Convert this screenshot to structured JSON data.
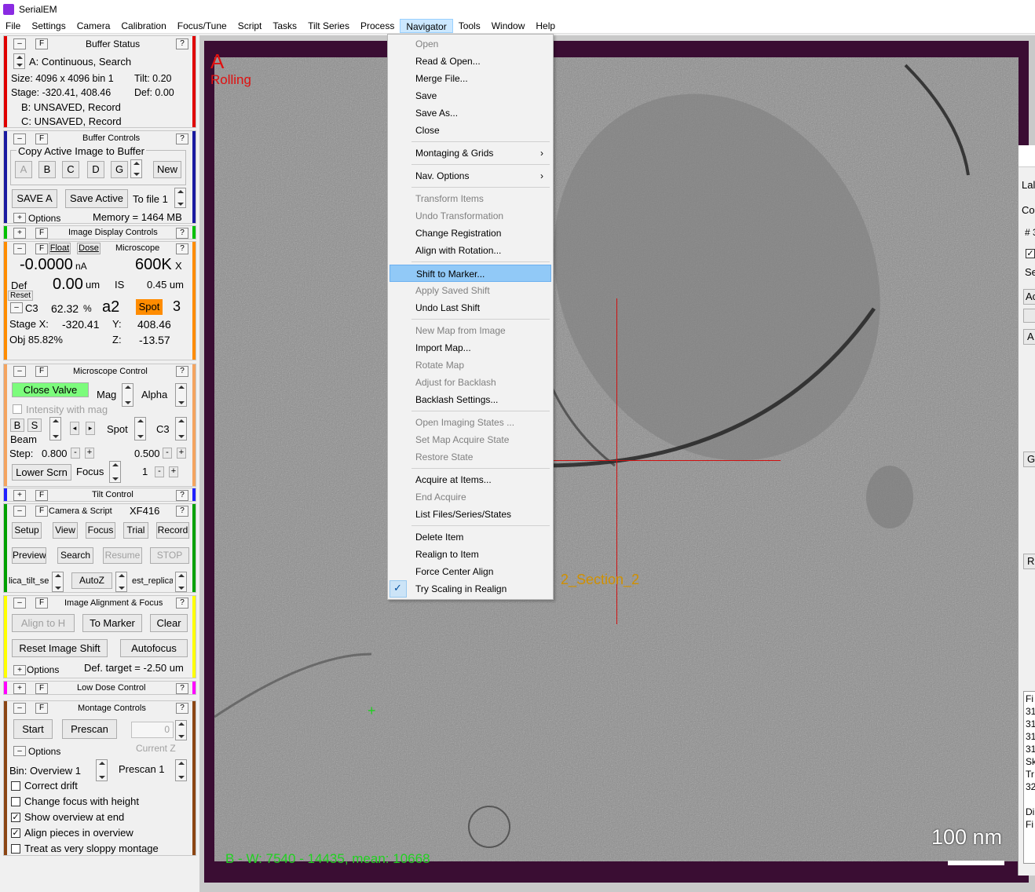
{
  "window": {
    "title": "SerialEM"
  },
  "menubar": [
    "File",
    "Settings",
    "Camera",
    "Calibration",
    "Focus/Tune",
    "Script",
    "Tasks",
    "Tilt Series",
    "Process",
    "Navigator",
    "Tools",
    "Window",
    "Help"
  ],
  "buffer_status": {
    "title": "Buffer Status",
    "line1": "A: Continuous, Search",
    "size": "Size: 4096 x 4096  bin 1",
    "tilt": "Tilt: 0.20",
    "stage": "Stage: -320.41, 408.46",
    "def": "Def: 0.00",
    "b": "B: UNSAVED, Record",
    "c": "C: UNSAVED, Record"
  },
  "buffer_controls": {
    "title": "Buffer Controls",
    "group": "Copy Active Image to Buffer",
    "buttons": [
      "A",
      "B",
      "C",
      "D",
      "G"
    ],
    "new": "New",
    "save_a": "SAVE A",
    "save_active": "Save Active",
    "to_file": "To file 1",
    "options": "Options",
    "memory": "Memory = 1464 MB"
  },
  "image_display": {
    "title": "Image Display Controls"
  },
  "microscope": {
    "float": "Float",
    "dose": "Dose",
    "title": "Microscope",
    "current": "-0.0000",
    "current_unit": "nA",
    "mag": "600K",
    "mag_x": "X",
    "def_label": "Def",
    "def_val": "0.00",
    "def_unit": "um",
    "is_label": "IS",
    "is_val": "0.45 um",
    "reset": "Reset",
    "c3_label": "C3",
    "c3_val": "62.32",
    "c3_pct": "%",
    "a2": "a2",
    "spot_label": "Spot",
    "spot_val": "3",
    "stagex_label": "Stage X:",
    "stagex": "-320.41",
    "y_label": "Y:",
    "y": "408.46",
    "obj": "Obj  85.82%",
    "z_label": "Z:",
    "z": "-13.57"
  },
  "microscope_control": {
    "title": "Microscope Control",
    "close_valve": "Close Valve",
    "mag": "Mag",
    "alpha": "Alpha",
    "intensity": "Intensity with mag",
    "b": "B",
    "s": "S",
    "beam": "Beam",
    "spot": "Spot",
    "c3": "C3",
    "step": "Step:",
    "step_val": "0.800",
    "step2": "0.500",
    "lower": "Lower Scrn",
    "focus": "Focus",
    "one": "1"
  },
  "tilt_control": {
    "title": "Tilt Control"
  },
  "camera_script": {
    "title": "Camera & Script",
    "camera": "XF416",
    "buttons1": [
      "Setup",
      "View",
      "Focus",
      "Trial",
      "Record"
    ],
    "buttons2": [
      "Preview",
      "Search",
      "Resume",
      "STOP"
    ],
    "script1": "lica_tilt_se",
    "autoz": "AutoZ",
    "script2": "est_replica"
  },
  "image_alignment": {
    "title": "Image Alignment & Focus",
    "align_to": "Align to H",
    "to_marker": "To Marker",
    "clear": "Clear",
    "reset_shift": "Reset Image Shift",
    "autofocus": "Autofocus",
    "options": "Options",
    "def_target": "Def. target = -2.50 um"
  },
  "low_dose": {
    "title": "Low Dose Control"
  },
  "montage": {
    "title": "Montage Controls",
    "start": "Start",
    "prescan": "Prescan",
    "zero": "0",
    "current_z": "Current Z",
    "options": "Options",
    "bin": "Bin: Overview 1",
    "prescan1": "Prescan 1",
    "opts": [
      {
        "label": "Correct drift",
        "checked": false
      },
      {
        "label": "Change focus with height",
        "checked": false
      },
      {
        "label": "Show overview at end",
        "checked": true
      },
      {
        "label": "Align pieces in overview",
        "checked": true
      },
      {
        "label": "Treat as very sloppy montage",
        "checked": false
      }
    ]
  },
  "image": {
    "buffer_letter": "A",
    "mode": "Rolling",
    "label": "2_Section_2",
    "scale": "100 nm",
    "stats": "B - W: 7540 - 14435, mean: 10668"
  },
  "navigator_menu": {
    "items": [
      {
        "label": "Open",
        "disabled": true
      },
      {
        "label": "Read & Open...",
        "disabled": false
      },
      {
        "label": "Merge File...",
        "disabled": false
      },
      {
        "label": "Save",
        "disabled": false
      },
      {
        "label": "Save As...",
        "disabled": false
      },
      {
        "label": "Close",
        "disabled": false
      },
      {
        "label": "Montaging & Grids",
        "disabled": false,
        "submenu": true
      },
      {
        "label": "Nav. Options",
        "disabled": false,
        "submenu": true
      },
      {
        "label": "Transform Items",
        "disabled": true
      },
      {
        "label": "Undo Transformation",
        "disabled": true
      },
      {
        "label": "Change Registration",
        "disabled": false
      },
      {
        "label": "Align with Rotation...",
        "disabled": false
      },
      {
        "label": "Shift to Marker...",
        "disabled": false,
        "highlighted": true
      },
      {
        "label": "Apply Saved Shift",
        "disabled": true
      },
      {
        "label": "Undo Last Shift",
        "disabled": false
      },
      {
        "label": "New Map from Image",
        "disabled": true
      },
      {
        "label": "Import Map...",
        "disabled": false
      },
      {
        "label": "Rotate Map",
        "disabled": true
      },
      {
        "label": "Adjust for Backlash",
        "disabled": true
      },
      {
        "label": "Backlash Settings...",
        "disabled": false
      },
      {
        "label": "Open Imaging States ...",
        "disabled": true
      },
      {
        "label": "Set Map Acquire State",
        "disabled": true
      },
      {
        "label": "Restore State",
        "disabled": true
      },
      {
        "label": "Acquire at Items...",
        "disabled": false
      },
      {
        "label": "End Acquire",
        "disabled": true
      },
      {
        "label": "List Files/Series/States",
        "disabled": false
      },
      {
        "label": "Delete Item",
        "disabled": false
      },
      {
        "label": "Realign to Item",
        "disabled": false
      },
      {
        "label": "Force Center Align",
        "disabled": false
      },
      {
        "label": "Try Scaling in Realign",
        "disabled": false,
        "checked": true
      }
    ]
  },
  "right_window": {
    "labels": [
      "Lal",
      "Co",
      "# 3",
      "Se",
      "Ac",
      "A",
      "G",
      "R",
      "Fi",
      "31",
      "31",
      "31",
      "31",
      "Sk",
      "Tr",
      "32",
      "Di",
      "Fi"
    ]
  },
  "colors": {
    "buffer_status": "#e00000",
    "buffer_controls": "#1a1aa0",
    "image_display": "#00c000",
    "microscope": "#ff8c00",
    "microscope_control": "#f4a460",
    "tilt": "#2020ff",
    "camera": "#00a000",
    "alignment": "#ffff00",
    "low_dose": "#ff00ff",
    "montage": "#8b4513",
    "highlight": "#91c9f7",
    "spot": "#ff8c00",
    "close_valve": "#7cfc7c"
  }
}
